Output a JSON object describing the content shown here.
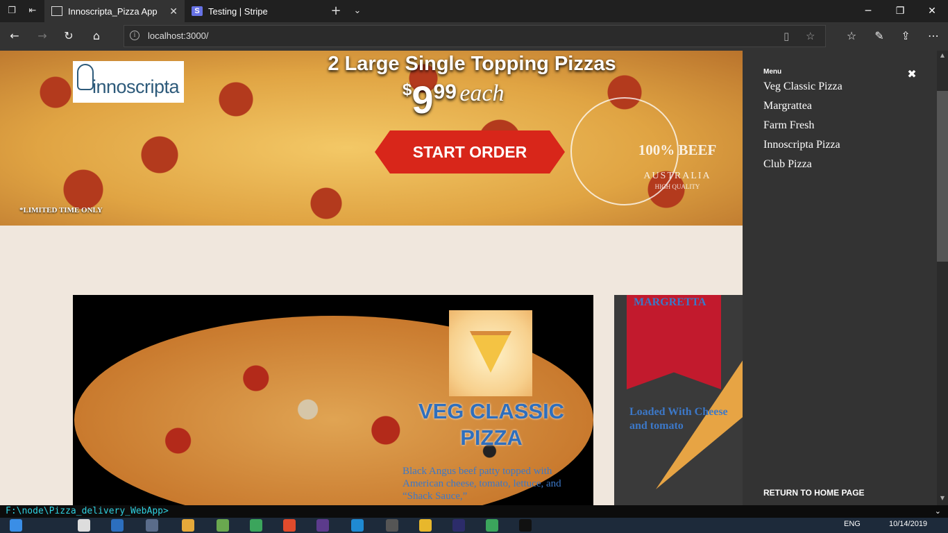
{
  "browser": {
    "tabs": [
      {
        "title": "Innoscripta_Pizza App",
        "active": true
      },
      {
        "title": "Testing | Stripe",
        "active": false
      }
    ],
    "address": "localhost:3000/"
  },
  "hero": {
    "logo_text": "innoscripta",
    "title": "2 Large Single Topping Pizzas",
    "price": {
      "dollar": "$",
      "big": "9",
      "cents": "99",
      "each": "each"
    },
    "cta": "START ORDER",
    "seal": {
      "main": "100% BEEF",
      "country": "AUSTRALIA",
      "quality": "HIGH QUALITY"
    },
    "limited": "*LIMITED TIME ONLY"
  },
  "cards": {
    "veg": {
      "title": "VEG CLASSIC PIZZA",
      "description": "Black Angus beef patty topped with American cheese, tomato, lettuce, and “Shack Sauce,”"
    },
    "margretta": {
      "title": "MARGRETTA",
      "text": "Loaded With Cheese and tomato"
    }
  },
  "sidebar": {
    "menu_label": "Menu",
    "items": [
      "Veg Classic Pizza",
      "Margrattea",
      "Farm Fresh",
      "Innoscripta Pizza",
      "Club Pizza"
    ],
    "return": "RETURN TO HOME PAGE"
  },
  "console": {
    "path": "F:\\node\\Pizza_delivery_WebApp>"
  },
  "taskbar": {
    "lang": "ENG",
    "date": "10/14/2019"
  },
  "colors": {
    "accent_red": "#d8261a",
    "title_blue": "#2f6fbd",
    "sidebar_bg": "#333333"
  }
}
